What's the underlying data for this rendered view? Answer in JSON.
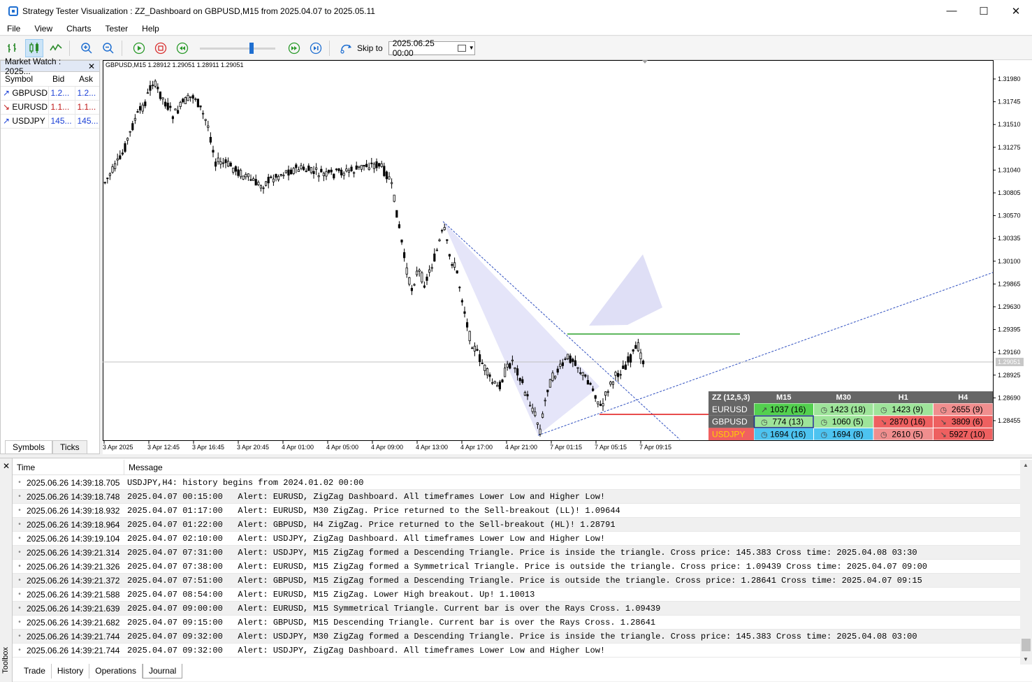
{
  "window": {
    "title": "Strategy Tester Visualization : ZZ_Dashboard on GBPUSD,M15 from 2025.04.07 to 2025.05.11",
    "minimize": "—",
    "maximize": "☐",
    "close": "✕"
  },
  "menu": [
    "File",
    "View",
    "Charts",
    "Tester",
    "Help"
  ],
  "toolbar": {
    "skip_label": "Skip to",
    "skip_date": "2025.06.25 00:00",
    "speed_percent": 70
  },
  "market_watch": {
    "title": "Market Watch : 2025...",
    "close": "✕",
    "headers": [
      "Symbol",
      "Bid",
      "Ask"
    ],
    "rows": [
      {
        "symbol": "GBPUSD",
        "bid": "1.2...",
        "ask": "1.2...",
        "dir": "up",
        "arrow": "↗"
      },
      {
        "symbol": "EURUSD",
        "bid": "1.1...",
        "ask": "1.1...",
        "dir": "down",
        "arrow": "↘"
      },
      {
        "symbol": "USDJPY",
        "bid": "145...",
        "ask": "145...",
        "dir": "up",
        "arrow": "↗"
      }
    ],
    "tabs": [
      "Symbols",
      "Ticks"
    ]
  },
  "chart": {
    "header": "GBPUSD,M15  1.28912 1.29051 1.28911 1.29051",
    "price_labels": [
      "1.31980",
      "1.31745",
      "1.31510",
      "1.31275",
      "1.31040",
      "1.30805",
      "1.30570",
      "1.30335",
      "1.30100",
      "1.29865",
      "1.29630",
      "1.29395",
      "1.29160",
      "1.28925",
      "1.28690",
      "1.28455"
    ],
    "current_price": "1.29051",
    "time_labels": [
      "3 Apr 2025",
      "3 Apr 12:45",
      "3 Apr 16:45",
      "3 Apr 20:45",
      "4 Apr 01:00",
      "4 Apr 05:00",
      "4 Apr 09:00",
      "4 Apr 13:00",
      "4 Apr 17:00",
      "4 Apr 21:00",
      "7 Apr 01:15",
      "7 Apr 05:15",
      "7 Apr 09:15"
    ]
  },
  "dashboard": {
    "title": "ZZ (12,5,3)",
    "columns": [
      "M15",
      "M30",
      "H1",
      "H4"
    ],
    "rows": [
      {
        "symbol": "EURUSD",
        "cells": [
          {
            "text": "1037 (16)",
            "state": "up-strong",
            "icon": "↗"
          },
          {
            "text": "1423 (18)",
            "state": "up",
            "icon": "◷"
          },
          {
            "text": "1423 (9)",
            "state": "up",
            "icon": "◷"
          },
          {
            "text": "2655 (9)",
            "state": "down",
            "icon": "◷"
          }
        ]
      },
      {
        "symbol": "GBPUSD",
        "cells": [
          {
            "text": "774 (13)",
            "state": "up-selected",
            "icon": "◷"
          },
          {
            "text": "1060 (5)",
            "state": "up",
            "icon": "◷"
          },
          {
            "text": "2870 (16)",
            "state": "down-strong",
            "icon": "↘"
          },
          {
            "text": "3809 (6)",
            "state": "down-strong",
            "icon": "↘"
          }
        ]
      },
      {
        "symbol": "USDJPY",
        "cells": [
          {
            "text": "1694 (16)",
            "state": "blue",
            "icon": "◷"
          },
          {
            "text": "1694 (8)",
            "state": "blue",
            "icon": "◷"
          },
          {
            "text": "2610 (5)",
            "state": "down",
            "icon": "◷"
          },
          {
            "text": "5927 (10)",
            "state": "down-strong",
            "icon": "↘"
          }
        ]
      }
    ],
    "colors": {
      "header": "#666666",
      "up-strong": "#53d04f",
      "up": "#9ee49a",
      "down": "#f08e8e",
      "down-strong": "#ee6060",
      "blue": "#4dc3f0",
      "usdjpy_label_bg": "#f16060",
      "usdjpy_label_fg": "#ffd200"
    }
  },
  "journal": {
    "headers": [
      "Time",
      "Message"
    ],
    "rows": [
      {
        "time": "2025.06.26 14:39:18.705",
        "msg": "USDJPY,H4: history begins from 2024.01.02 00:00"
      },
      {
        "time": "2025.06.26 14:39:18.748",
        "msg": "2025.04.07 00:15:00   Alert: EURUSD, ZigZag Dashboard. All timeframes Lower Low and Higher Low!"
      },
      {
        "time": "2025.06.26 14:39:18.932",
        "msg": "2025.04.07 01:17:00   Alert: EURUSD, M30 ZigZag. Price returned to the Sell-breakout (LL)! 1.09644"
      },
      {
        "time": "2025.06.26 14:39:18.964",
        "msg": "2025.04.07 01:22:00   Alert: GBPUSD, H4 ZigZag. Price returned to the Sell-breakout (HL)! 1.28791"
      },
      {
        "time": "2025.06.26 14:39:19.104",
        "msg": "2025.04.07 02:10:00   Alert: USDJPY, ZigZag Dashboard. All timeframes Lower Low and Higher Low!"
      },
      {
        "time": "2025.06.26 14:39:21.314",
        "msg": "2025.04.07 07:31:00   Alert: USDJPY, M15 ZigZag formed a Descending Triangle. Price is inside the triangle. Cross price: 145.383 Cross time: 2025.04.08 03:30"
      },
      {
        "time": "2025.06.26 14:39:21.326",
        "msg": "2025.04.07 07:38:00   Alert: EURUSD, M15 ZigZag formed a Symmetrical Triangle. Price is outside the triangle. Cross price: 1.09439 Cross time: 2025.04.07 09:00"
      },
      {
        "time": "2025.06.26 14:39:21.372",
        "msg": "2025.04.07 07:51:00   Alert: GBPUSD, M15 ZigZag formed a Descending Triangle. Price is outside the triangle. Cross price: 1.28641 Cross time: 2025.04.07 09:15"
      },
      {
        "time": "2025.06.26 14:39:21.588",
        "msg": "2025.04.07 08:54:00   Alert: EURUSD, M15 ZigZag. Lower High breakout. Up! 1.10013"
      },
      {
        "time": "2025.06.26 14:39:21.639",
        "msg": "2025.04.07 09:00:00   Alert: EURUSD, M15 Symmetrical Triangle. Current bar is over the Rays Cross. 1.09439"
      },
      {
        "time": "2025.06.26 14:39:21.682",
        "msg": "2025.04.07 09:15:00   Alert: GBPUSD, M15 Descending Triangle. Current bar is over the Rays Cross. 1.28641"
      },
      {
        "time": "2025.06.26 14:39:21.744",
        "msg": "2025.04.07 09:32:00   Alert: USDJPY, M30 ZigZag formed a Descending Triangle. Price is inside the triangle. Cross price: 145.383 Cross time: 2025.04.08 03:00"
      },
      {
        "time": "2025.06.26 14:39:21.744",
        "msg": "2025.04.07 09:32:00   Alert: USDJPY, ZigZag Dashboard. All timeframes Lower Low and Higher Low!"
      }
    ],
    "tabs": [
      "Trade",
      "History",
      "Operations",
      "Journal"
    ],
    "active_tab": "Journal",
    "toolbox_label": "Toolbox",
    "close": "✕"
  }
}
